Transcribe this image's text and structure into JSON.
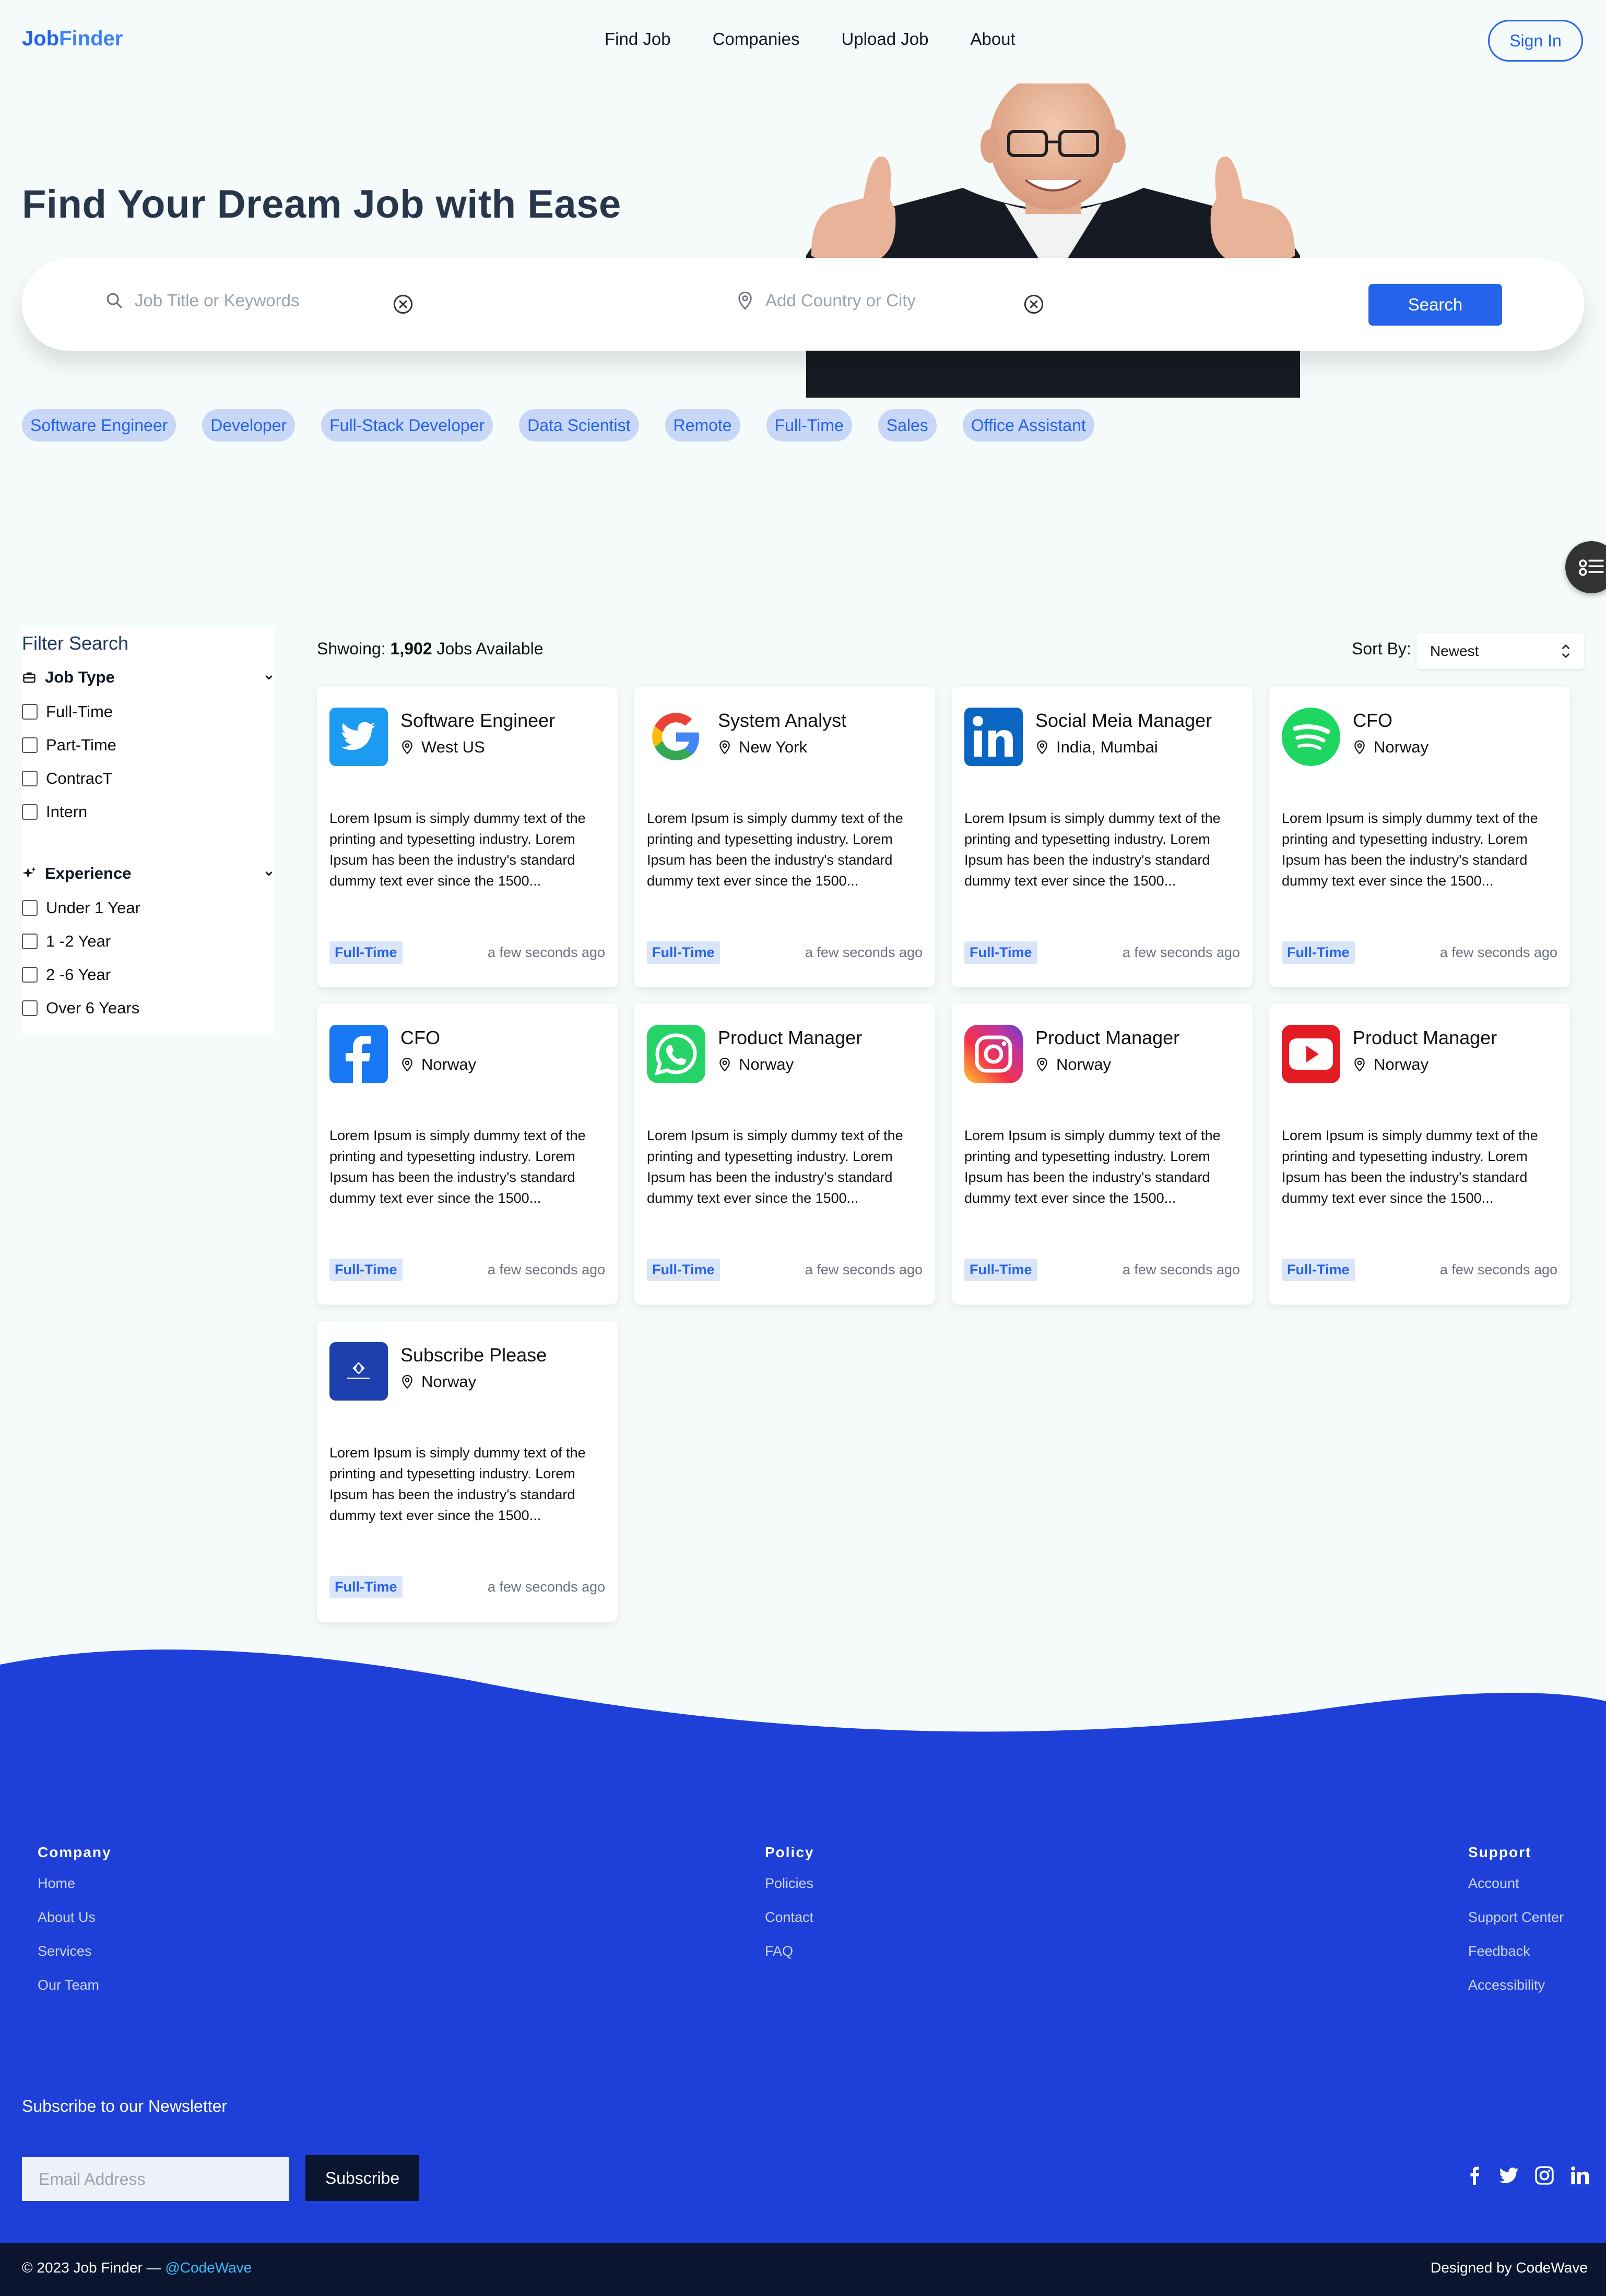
{
  "brand": {
    "part1": "Job",
    "part2": "Finder"
  },
  "nav": {
    "items": [
      "Find Job",
      "Companies",
      "Upload Job",
      "About"
    ],
    "sign_in": "Sign In"
  },
  "hero": {
    "title": "Find Your Dream Job with Ease",
    "keyword_placeholder": "Job Title or Keywords",
    "location_placeholder": "Add Country or City",
    "search_label": "Search"
  },
  "tags": [
    "Software Engineer",
    "Developer",
    "Full-Stack Developer",
    "Data Scientist",
    "Remote",
    "Full-Time",
    "Sales",
    "Office Assistant"
  ],
  "filter": {
    "title": "Filter Search",
    "job_type": {
      "label": "Job Type",
      "options": [
        "Full-Time",
        "Part-Time",
        "ContracT",
        "Intern"
      ]
    },
    "experience": {
      "label": "Experience",
      "options": [
        "Under 1 Year",
        "1 -2 Year",
        "2 -6 Year",
        "Over 6 Years"
      ]
    }
  },
  "listing": {
    "showing_prefix": "Shwoing: ",
    "count": "1,902",
    "showing_suffix": " Jobs Available",
    "sort_label": "Sort By:",
    "sort_value": "Newest"
  },
  "jobs": [
    {
      "title": "Software Engineer",
      "location": "West US",
      "logo": "twitter-logo",
      "type": "Full-Time",
      "posted": "a few seconds ago",
      "description": "Lorem Ipsum is simply dummy text of the printing and typesetting industry. Lorem Ipsum has been the industry's standard dummy text ever since the 1500..."
    },
    {
      "title": "System Analyst",
      "location": "New York",
      "logo": "google-logo",
      "type": "Full-Time",
      "posted": "a few seconds ago",
      "description": "Lorem Ipsum is simply dummy text of the printing and typesetting industry. Lorem Ipsum has been the industry's standard dummy text ever since the 1500..."
    },
    {
      "title": "Social Meia Manager",
      "location": "India, Mumbai",
      "logo": "linkedin-logo",
      "type": "Full-Time",
      "posted": "a few seconds ago",
      "description": "Lorem Ipsum is simply dummy text of the printing and typesetting industry. Lorem Ipsum has been the industry's standard dummy text ever since the 1500..."
    },
    {
      "title": "CFO",
      "location": "Norway",
      "logo": "spotify-logo",
      "type": "Full-Time",
      "posted": "a few seconds ago",
      "description": "Lorem Ipsum is simply dummy text of the printing and typesetting industry. Lorem Ipsum has been the industry's standard dummy text ever since the 1500..."
    },
    {
      "title": "CFO",
      "location": "Norway",
      "logo": "facebook-logo",
      "type": "Full-Time",
      "posted": "a few seconds ago",
      "description": "Lorem Ipsum is simply dummy text of the printing and typesetting industry. Lorem Ipsum has been the industry's standard dummy text ever since the 1500..."
    },
    {
      "title": "Product Manager",
      "location": "Norway",
      "logo": "whatsapp-logo",
      "type": "Full-Time",
      "posted": "a few seconds ago",
      "description": "Lorem Ipsum is simply dummy text of the printing and typesetting industry. Lorem Ipsum has been the industry's standard dummy text ever since the 1500..."
    },
    {
      "title": "Product Manager",
      "location": "Norway",
      "logo": "instagram-logo",
      "type": "Full-Time",
      "posted": "a few seconds ago",
      "description": "Lorem Ipsum is simply dummy text of the printing and typesetting industry. Lorem Ipsum has been the industry's standard dummy text ever since the 1500..."
    },
    {
      "title": "Product Manager",
      "location": "Norway",
      "logo": "youtube-logo",
      "type": "Full-Time",
      "posted": "a few seconds ago",
      "description": "Lorem Ipsum is simply dummy text of the printing and typesetting industry. Lorem Ipsum has been the industry's standard dummy text ever since the 1500..."
    },
    {
      "title": "Subscribe Please",
      "location": "Norway",
      "logo": "codewave-logo",
      "type": "Full-Time",
      "posted": "a few seconds ago",
      "description": "Lorem Ipsum is simply dummy text of the printing and typesetting industry. Lorem Ipsum has been the industry's standard dummy text ever since the 1500..."
    }
  ],
  "footer": {
    "company": {
      "title": "Company",
      "links": [
        "Home",
        "About Us",
        "Services",
        "Our Team"
      ]
    },
    "policy": {
      "title": "Policy",
      "links": [
        "Policies",
        "Contact",
        "FAQ"
      ]
    },
    "support": {
      "title": "Support",
      "links": [
        "Account",
        "Support Center",
        "Feedback",
        "Accessibility"
      ]
    },
    "newsletter_title": "Subscribe to our Newsletter",
    "email_placeholder": "Email Address",
    "subscribe_label": "Subscribe",
    "social_icons": [
      "facebook-icon",
      "twitter-icon",
      "instagram-icon",
      "linkedin-icon"
    ],
    "copyright": "© 2023 Job Finder — ",
    "copyright_handle": "@CodeWave",
    "designed_by": "Designed by CodeWave"
  },
  "colors": {
    "primary": "#2563eb",
    "footer": "#1e40d8",
    "dark": "#0b1530",
    "background": "#f5fbfb"
  }
}
